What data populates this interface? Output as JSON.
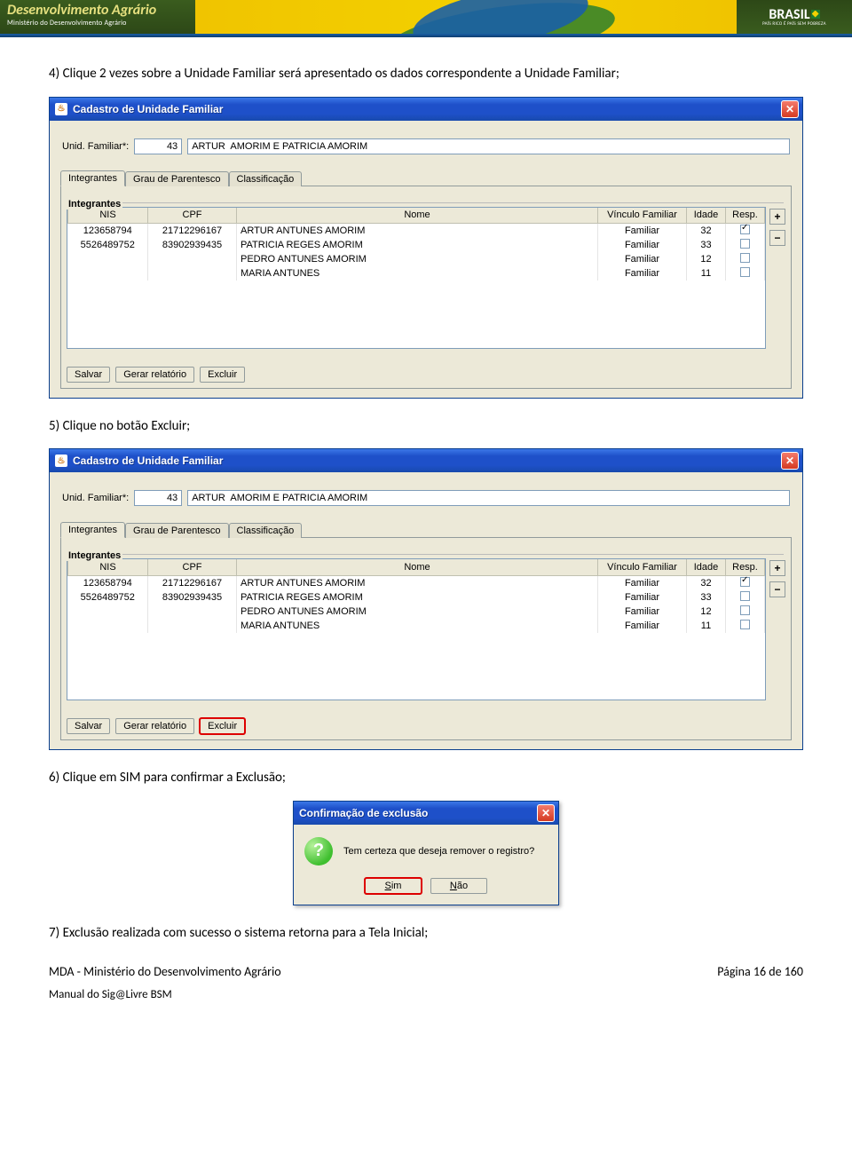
{
  "banner": {
    "title": "Desenvolvimento Agrário",
    "subtitle": "Ministério do Desenvolvimento Agrário",
    "logo_text": "BRASIL",
    "logo_tag": "PAÍS RICO É PAÍS SEM POBREZA"
  },
  "steps": {
    "s4_num": "4)",
    "s4_text": "Clique 2 vezes sobre a Unidade Familiar será apresentado os dados correspondente a Unidade Familiar;",
    "s5_num": "5)",
    "s5_text": "Clique no botão Excluir;",
    "s6_num": "6)",
    "s6_text": "Clique em SIM para confirmar a Exclusão;",
    "s7_num": "7)",
    "s7_text": "Exclusão realizada com sucesso o sistema retorna para a Tela Inicial;"
  },
  "window": {
    "title": "Cadastro de Unidade Familiar",
    "label_unid": "Unid. Familiar*:",
    "num_value": "43",
    "name_value": "ARTUR  AMORIM E PATRICIA AMORIM",
    "tabs": {
      "integrantes": "Integrantes",
      "grau": "Grau de Parentesco",
      "class": "Classificação"
    },
    "legend": "Integrantes",
    "columns": {
      "nis": "NIS",
      "cpf": "CPF",
      "nome": "Nome",
      "vinculo": "Vínculo Familiar",
      "idade": "Idade",
      "resp": "Resp."
    },
    "rows": [
      {
        "nis": "123658794",
        "cpf": "21712296167",
        "nome": "ARTUR ANTUNES AMORIM",
        "vinc": "Familiar",
        "idade": "32",
        "resp": true
      },
      {
        "nis": "5526489752",
        "cpf": "83902939435",
        "nome": "PATRICIA REGES AMORIM",
        "vinc": "Familiar",
        "idade": "33",
        "resp": false
      },
      {
        "nis": "",
        "cpf": "",
        "nome": "PEDRO ANTUNES AMORIM",
        "vinc": "Familiar",
        "idade": "12",
        "resp": false
      },
      {
        "nis": "",
        "cpf": "",
        "nome": "MARIA ANTUNES",
        "vinc": "Familiar",
        "idade": "11",
        "resp": false
      }
    ],
    "buttons": {
      "salvar": "Salvar",
      "relatorio": "Gerar relatório",
      "excluir": "Excluir"
    },
    "side": {
      "plus": "+",
      "minus": "−"
    }
  },
  "dialog": {
    "title": "Confirmação de exclusão",
    "msg": "Tem certeza que deseja remover o registro?",
    "sim": "Sim",
    "nao": "Não"
  },
  "footer": {
    "left": "MDA - Ministério do Desenvolvimento Agrário",
    "right": "Página 16 de 160",
    "manual": "Manual do Sig@Livre BSM"
  }
}
